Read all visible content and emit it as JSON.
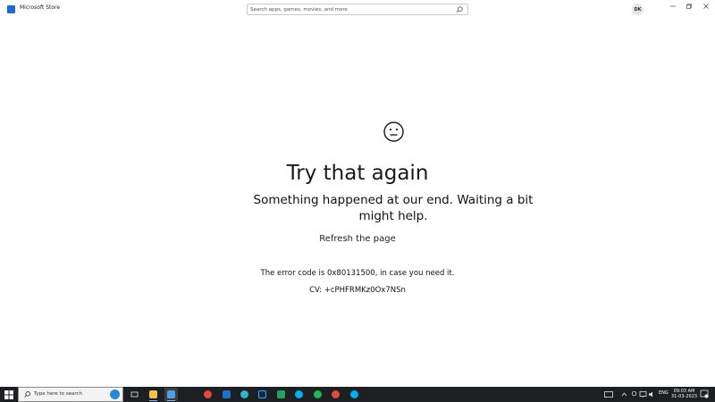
{
  "window": {
    "title": "Microsoft Store",
    "avatar_initials": "DK"
  },
  "search": {
    "placeholder": "Search apps, games, movies, and more"
  },
  "error": {
    "title": "Try that again",
    "message": "Something happened at our end. Waiting a bit might help.",
    "refresh_label": "Refresh the page",
    "code_text": "The error code is 0x80131500, in case you need it.",
    "cv_text": "CV: +cPHFRMKz0Ox7NSn"
  },
  "taskbar": {
    "search_placeholder": "Type here to search",
    "apps": [
      {
        "name": "task-view",
        "color": "#ffffff"
      },
      {
        "name": "file-explorer",
        "color": "#f2c14e"
      },
      {
        "name": "microsoft-store",
        "color": "#4a9fe8"
      },
      {
        "name": "chrome",
        "color": "#e5493a"
      },
      {
        "name": "outlook",
        "color": "#1a73c8"
      },
      {
        "name": "edge",
        "color": "#2fb4c8"
      },
      {
        "name": "photoshop",
        "color": "#31a8ff"
      },
      {
        "name": "excel",
        "color": "#21a366"
      },
      {
        "name": "skype",
        "color": "#00aff0"
      },
      {
        "name": "spotify",
        "color": "#1db954"
      },
      {
        "name": "chrome-2",
        "color": "#e5493a"
      },
      {
        "name": "skype-2",
        "color": "#00aff0"
      }
    ],
    "language": "ENG",
    "time": "09:03 AM",
    "date": "31-03-2023"
  }
}
